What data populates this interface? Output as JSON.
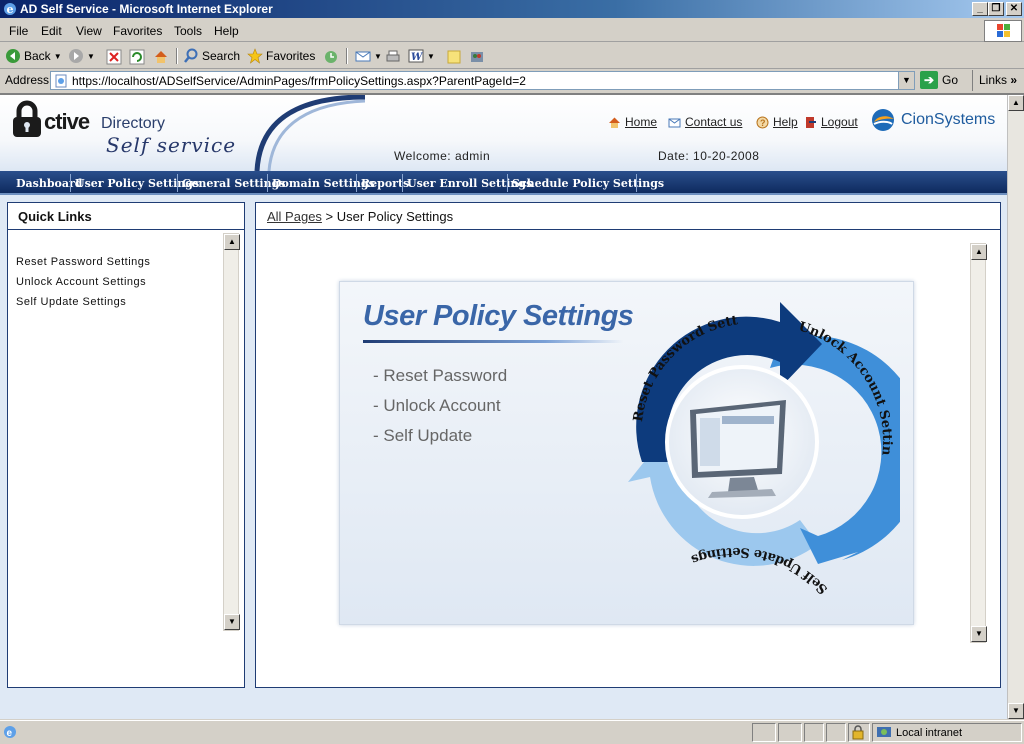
{
  "window": {
    "title": "AD Self Service - Microsoft Internet Explorer"
  },
  "menu": [
    "File",
    "Edit",
    "View",
    "Favorites",
    "Tools",
    "Help"
  ],
  "toolbar": {
    "back": "Back",
    "search": "Search",
    "favorites": "Favorites"
  },
  "address": {
    "label": "Address",
    "url": "https://localhost/ADSelfService/AdminPages/frmPolicySettings.aspx?ParentPageId=2",
    "go": "Go",
    "links": "Links"
  },
  "header": {
    "logo_ctive": "ctive",
    "logo_directory": "Directory",
    "logo_self": "Self service",
    "links": {
      "home": "Home",
      "contact": "Contact us",
      "help": "Help",
      "logout": "Logout"
    },
    "brand": "CionSystems",
    "welcome": "Welcome: admin",
    "date": "Date: 10-20-2008"
  },
  "nav": [
    "Dashboard",
    "User Policy Settings",
    "General Settings",
    "Domain Settings",
    "Reports",
    "User Enroll Settings",
    "Schedule Policy Settings"
  ],
  "quick_links": {
    "title": "Quick Links",
    "items": [
      "Reset Password Settings",
      "Unlock Account Settings",
      "Self Update Settings"
    ]
  },
  "breadcrumb": {
    "root": "All Pages",
    "separator": " > ",
    "current": "User Policy Settings"
  },
  "policy_graphic": {
    "title": "User Policy Settings",
    "items": [
      "- Reset Password",
      "- Unlock Account",
      "- Self Update"
    ],
    "cycle_labels": [
      "Reset Password Settings",
      "Unlock Account Settings",
      "Self Update Settings"
    ]
  },
  "statusbar": {
    "zone": "Local intranet"
  },
  "colors": {
    "nav_bg": "#0e2a5e",
    "panel_border": "#1f3c74",
    "arrow_dark": "#0d3b7d",
    "arrow_mid": "#3f8fd9",
    "arrow_light": "#9cc8ee"
  }
}
